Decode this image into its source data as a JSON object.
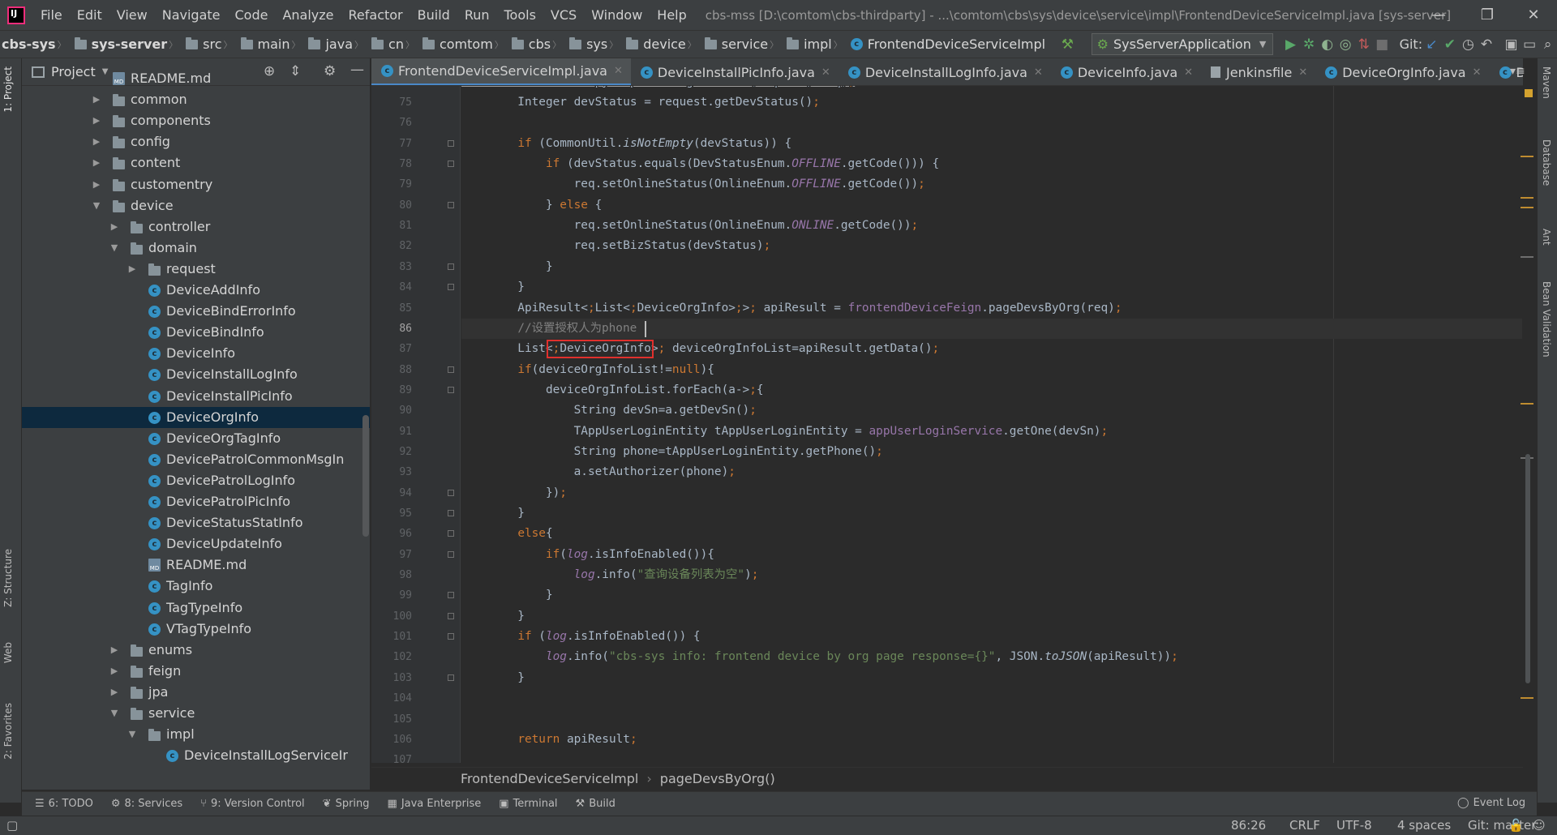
{
  "window": {
    "title": "cbs-mss [D:\\comtom\\cbs-thirdparty] - ...\\comtom\\cbs\\sys\\device\\service\\impl\\FrontendDeviceServiceImpl.java [sys-server]"
  },
  "menu": [
    "File",
    "Edit",
    "View",
    "Navigate",
    "Code",
    "Analyze",
    "Refactor",
    "Build",
    "Run",
    "Tools",
    "VCS",
    "Window",
    "Help"
  ],
  "breadcrumb": [
    "cbs-sys",
    "sys-server",
    "src",
    "main",
    "java",
    "cn",
    "comtom",
    "cbs",
    "sys",
    "device",
    "service",
    "impl",
    "FrontendDeviceServiceImpl"
  ],
  "run_config": "SysServerApplication",
  "git_label": "Git:",
  "project_panel": {
    "title": "Project",
    "tree": [
      {
        "label": "README.md",
        "type": "md",
        "depth": 0,
        "arrow": ""
      },
      {
        "label": "common",
        "type": "folder",
        "depth": 0,
        "arrow": "closed"
      },
      {
        "label": "components",
        "type": "folder",
        "depth": 0,
        "arrow": "closed"
      },
      {
        "label": "config",
        "type": "folder",
        "depth": 0,
        "arrow": "closed"
      },
      {
        "label": "content",
        "type": "folder",
        "depth": 0,
        "arrow": "closed"
      },
      {
        "label": "customentry",
        "type": "folder",
        "depth": 0,
        "arrow": "closed"
      },
      {
        "label": "device",
        "type": "folder",
        "depth": 0,
        "arrow": "open"
      },
      {
        "label": "controller",
        "type": "folder",
        "depth": 1,
        "arrow": "closed"
      },
      {
        "label": "domain",
        "type": "folder",
        "depth": 1,
        "arrow": "open"
      },
      {
        "label": "request",
        "type": "folder",
        "depth": 2,
        "arrow": "closed"
      },
      {
        "label": "DeviceAddInfo",
        "type": "class",
        "depth": 2,
        "arrow": ""
      },
      {
        "label": "DeviceBindErrorInfo",
        "type": "class",
        "depth": 2,
        "arrow": ""
      },
      {
        "label": "DeviceBindInfo",
        "type": "class",
        "depth": 2,
        "arrow": ""
      },
      {
        "label": "DeviceInfo",
        "type": "class",
        "depth": 2,
        "arrow": ""
      },
      {
        "label": "DeviceInstallLogInfo",
        "type": "class",
        "depth": 2,
        "arrow": ""
      },
      {
        "label": "DeviceInstallPicInfo",
        "type": "class",
        "depth": 2,
        "arrow": ""
      },
      {
        "label": "DeviceOrgInfo",
        "type": "class",
        "depth": 2,
        "arrow": "",
        "selected": true
      },
      {
        "label": "DeviceOrgTagInfo",
        "type": "class",
        "depth": 2,
        "arrow": ""
      },
      {
        "label": "DevicePatrolCommonMsgIn",
        "type": "class",
        "depth": 2,
        "arrow": ""
      },
      {
        "label": "DevicePatrolLogInfo",
        "type": "class",
        "depth": 2,
        "arrow": ""
      },
      {
        "label": "DevicePatrolPicInfo",
        "type": "class",
        "depth": 2,
        "arrow": ""
      },
      {
        "label": "DeviceStatusStatInfo",
        "type": "class",
        "depth": 2,
        "arrow": ""
      },
      {
        "label": "DeviceUpdateInfo",
        "type": "class",
        "depth": 2,
        "arrow": ""
      },
      {
        "label": "README.md",
        "type": "md",
        "depth": 2,
        "arrow": ""
      },
      {
        "label": "TagInfo",
        "type": "class",
        "depth": 2,
        "arrow": ""
      },
      {
        "label": "TagTypeInfo",
        "type": "class",
        "depth": 2,
        "arrow": ""
      },
      {
        "label": "VTagTypeInfo",
        "type": "class",
        "depth": 2,
        "arrow": ""
      },
      {
        "label": "enums",
        "type": "folder",
        "depth": 1,
        "arrow": "closed"
      },
      {
        "label": "feign",
        "type": "folder",
        "depth": 1,
        "arrow": "closed"
      },
      {
        "label": "jpa",
        "type": "folder",
        "depth": 1,
        "arrow": "closed"
      },
      {
        "label": "service",
        "type": "folder",
        "depth": 1,
        "arrow": "open"
      },
      {
        "label": "impl",
        "type": "folder",
        "depth": 2,
        "arrow": "open"
      },
      {
        "label": "DeviceInstallLogServiceIr",
        "type": "class",
        "depth": 3,
        "arrow": ""
      }
    ]
  },
  "editor_tabs": [
    {
      "label": "FrontendDeviceServiceImpl.java",
      "active": true,
      "icon": "class"
    },
    {
      "label": "DeviceInstallPicInfo.java",
      "icon": "class"
    },
    {
      "label": "DeviceInstallLogInfo.java",
      "icon": "class"
    },
    {
      "label": "DeviceInfo.java",
      "icon": "class"
    },
    {
      "label": "Jenkinsfile",
      "icon": "file"
    },
    {
      "label": "DeviceOrgInfo.java",
      "icon": "class"
    },
    {
      "label": "DeviceOrg",
      "icon": "class"
    }
  ],
  "code": {
    "current_line": 86,
    "lines": [
      {
        "n": 75,
        "text": "        Integer devStatus = request.getDevStatus();"
      },
      {
        "n": 76,
        "text": ""
      },
      {
        "n": 77,
        "text": "        if (CommonUtil.isNotEmpty(devStatus)) {"
      },
      {
        "n": 78,
        "text": "            if (devStatus.equals(DevStatusEnum.OFFLINE.getCode())) {"
      },
      {
        "n": 79,
        "text": "                req.setOnlineStatus(OnlineEnum.OFFLINE.getCode());"
      },
      {
        "n": 80,
        "text": "            } else {"
      },
      {
        "n": 81,
        "text": "                req.setOnlineStatus(OnlineEnum.ONLINE.getCode());"
      },
      {
        "n": 82,
        "text": "                req.setBizStatus(devStatus);"
      },
      {
        "n": 83,
        "text": "            }"
      },
      {
        "n": 84,
        "text": "        }"
      },
      {
        "n": 85,
        "text": "        ApiResult<List<DeviceOrgInfo>> apiResult = frontendDeviceFeign.pageDevsByOrg(req);"
      },
      {
        "n": 86,
        "text": "        //设置授权人为phone"
      },
      {
        "n": 87,
        "text": "        List<DeviceOrgInfo> deviceOrgInfoList=apiResult.getData();"
      },
      {
        "n": 88,
        "text": "        if(deviceOrgInfoList!=null){"
      },
      {
        "n": 89,
        "text": "            deviceOrgInfoList.forEach(a->{"
      },
      {
        "n": 90,
        "text": "                String devSn=a.getDevSn();"
      },
      {
        "n": 91,
        "text": "                TAppUserLoginEntity tAppUserLoginEntity = appUserLoginService.getOne(devSn);"
      },
      {
        "n": 92,
        "text": "                String phone=tAppUserLoginEntity.getPhone();"
      },
      {
        "n": 93,
        "text": "                a.setAuthorizer(phone);"
      },
      {
        "n": 94,
        "text": "            });"
      },
      {
        "n": 95,
        "text": "        }"
      },
      {
        "n": 96,
        "text": "        else{"
      },
      {
        "n": 97,
        "text": "            if(log.isInfoEnabled()){"
      },
      {
        "n": 98,
        "text": "                log.info(\"查询设备列表为空\");"
      },
      {
        "n": 99,
        "text": "            }"
      },
      {
        "n": 100,
        "text": "        }"
      },
      {
        "n": 101,
        "text": "        if (log.isInfoEnabled()) {"
      },
      {
        "n": 102,
        "text": "            log.info(\"cbs-sys info: frontend device by org page response={}\", JSON.toJSON(apiResult));"
      },
      {
        "n": 103,
        "text": "        }"
      },
      {
        "n": 104,
        "text": ""
      },
      {
        "n": 105,
        "text": ""
      },
      {
        "n": 106,
        "text": "        return apiResult;"
      },
      {
        "n": 107,
        "text": ""
      }
    ],
    "partial_top_line": "        BeanUtil.copyPropertiesIgnoreNull(request, req);"
  },
  "editor_breadcrumb": [
    "FrontendDeviceServiceImpl",
    "pageDevsByOrg()"
  ],
  "bottom_tools": [
    {
      "label": "6: TODO",
      "icon": "list-icon"
    },
    {
      "label": "8: Services",
      "icon": "services-icon"
    },
    {
      "label": "9: Version Control",
      "icon": "vcs-icon"
    },
    {
      "label": "Spring",
      "icon": "spring-icon"
    },
    {
      "label": "Java Enterprise",
      "icon": "java-ee-icon"
    },
    {
      "label": "Terminal",
      "icon": "terminal-icon"
    },
    {
      "label": "Build",
      "icon": "build-icon"
    }
  ],
  "event_log": "Event Log",
  "status": {
    "position": "86:26",
    "line_sep": "CRLF",
    "encoding": "UTF-8",
    "indent": "4 spaces",
    "git": "Git: master"
  },
  "left_strip_tabs": [
    "1: Project",
    "Z: Structure",
    "Web",
    "2: Favorites"
  ],
  "right_strip_tabs": [
    "Maven",
    "Database",
    "Ant",
    "Bean Validation"
  ],
  "colors": {
    "accent": "#4a88c7",
    "selection": "#0d293e",
    "highlight_box": "#e0302d"
  }
}
